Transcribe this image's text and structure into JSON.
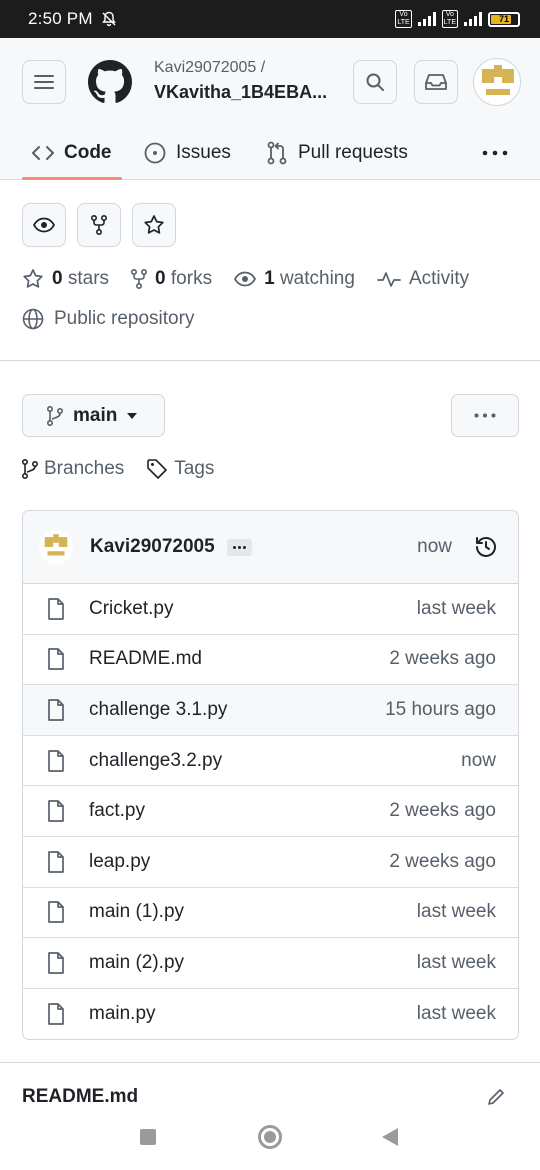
{
  "status_bar": {
    "time": "2:50 PM",
    "battery": "71",
    "network": "4G"
  },
  "header": {
    "owner": "Kavi29072005 /",
    "repo_name": "VKavitha_1B4EBA...",
    "tabs": [
      {
        "label": "Code",
        "icon": "code-icon"
      },
      {
        "label": "Issues",
        "icon": "issue-icon"
      },
      {
        "label": "Pull requests",
        "icon": "pull-request-icon"
      }
    ]
  },
  "stats": {
    "stars_count": "0",
    "stars_label": "stars",
    "forks_count": "0",
    "forks_label": "forks",
    "watching_count": "1",
    "watching_label": "watching",
    "activity_label": "Activity",
    "visibility": "Public repository"
  },
  "branch": {
    "current": "main",
    "branches_label": "Branches",
    "tags_label": "Tags"
  },
  "latest_commit": {
    "user": "Kavi29072005",
    "time": "now"
  },
  "files": [
    {
      "name": "Cricket.py",
      "time": "last week"
    },
    {
      "name": "README.md",
      "time": "2 weeks ago"
    },
    {
      "name": "challenge 3.1.py",
      "time": "15 hours ago"
    },
    {
      "name": "challenge3.2.py",
      "time": "now"
    },
    {
      "name": "fact.py",
      "time": "2 weeks ago"
    },
    {
      "name": "leap.py",
      "time": "2 weeks ago"
    },
    {
      "name": "main (1).py",
      "time": "last week"
    },
    {
      "name": "main (2).py",
      "time": "last week"
    },
    {
      "name": "main.py",
      "time": "last week"
    }
  ],
  "readme": {
    "title": "README.md"
  },
  "colors": {
    "accent_underline": "#fd8c73",
    "avatar_gold": "#d4b453",
    "text_muted": "#57606a"
  }
}
